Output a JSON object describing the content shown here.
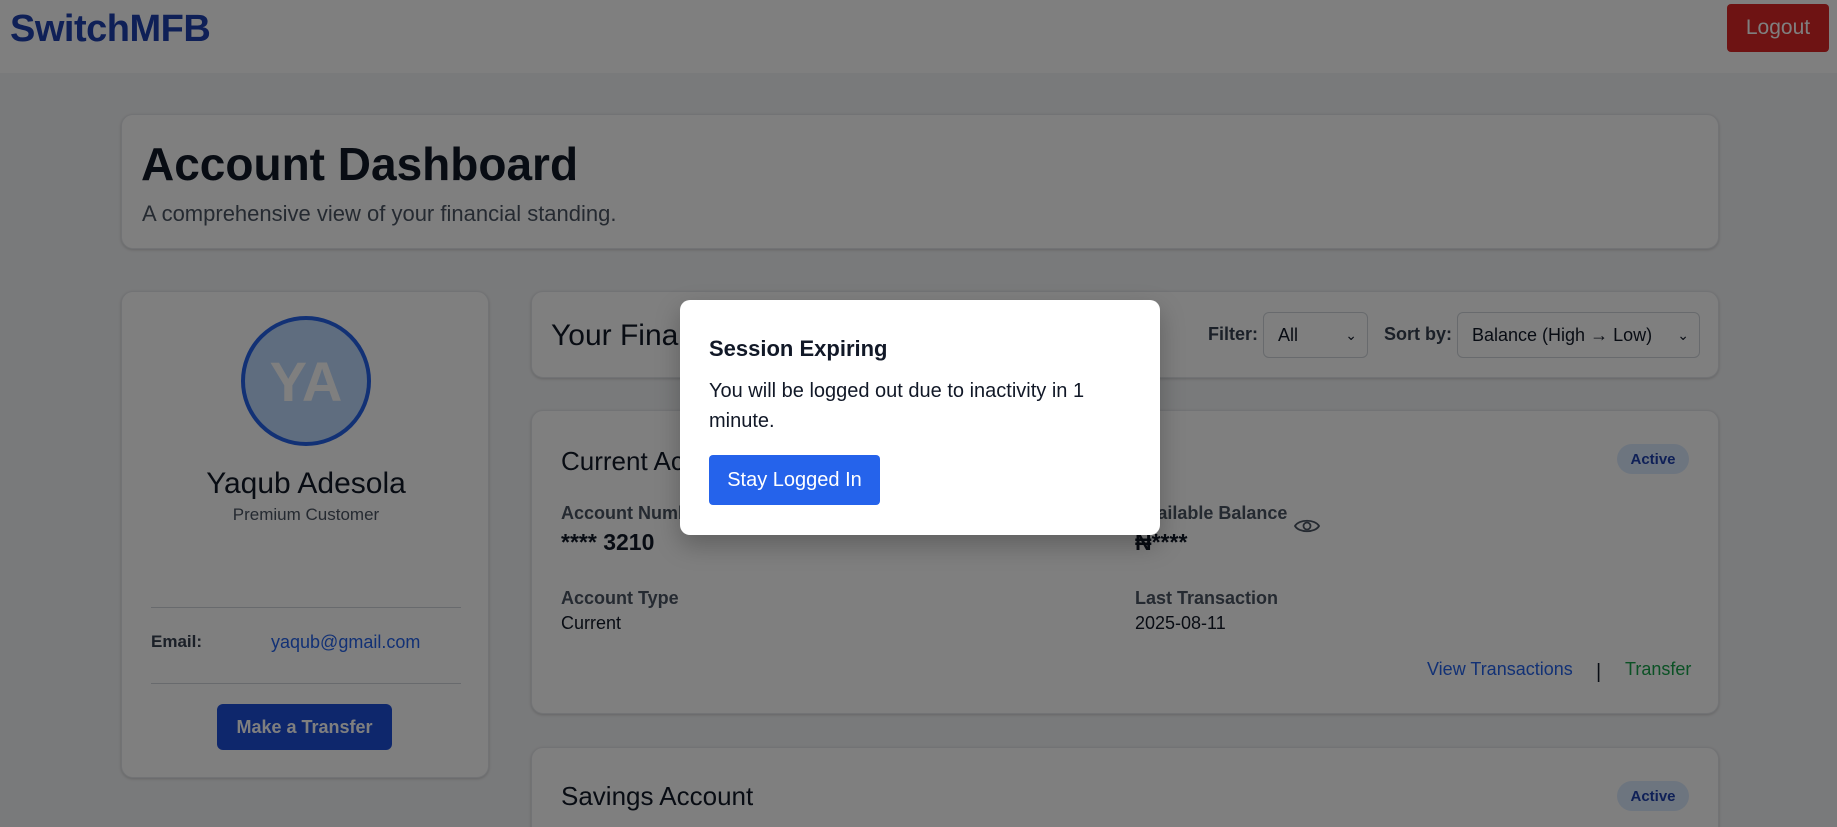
{
  "header": {
    "brand": "SwitchMFB",
    "logout_label": "Logout"
  },
  "page": {
    "title": "Account Dashboard",
    "subtitle": "A comprehensive view of your financial standing."
  },
  "profile": {
    "initials": "YA",
    "name": "Yaqub Adesola",
    "tier": "Premium Customer",
    "email_label": "Email:",
    "email": "yaqub@gmail.com",
    "transfer_button": "Make a Transfer"
  },
  "accounts_section": {
    "title": "Your Financial Accounts",
    "filter_label": "Filter:",
    "filter_value": "All",
    "sort_label": "Sort by:",
    "sort_value": "Balance (High → Low)"
  },
  "accounts": [
    {
      "name": "Current Account",
      "status": "Active",
      "number_label": "Account Number",
      "number": "**** 3210",
      "balance_label": "Available Balance",
      "balance": "₦****",
      "type_label": "Account Type",
      "type": "Current",
      "last_tx_label": "Last Transaction",
      "last_tx": "2025-08-11",
      "view_link": "View Transactions",
      "separator": "|",
      "transfer_link": "Transfer"
    },
    {
      "name": "Savings Account",
      "status": "Active"
    }
  ],
  "modal": {
    "title": "Session Expiring",
    "body": "You will be logged out due to inactivity in 1 minute.",
    "button": "Stay Logged In"
  },
  "colors": {
    "brand": "#1e40af",
    "primary": "#2563eb",
    "danger": "#dc2626",
    "success": "#16a34a"
  }
}
